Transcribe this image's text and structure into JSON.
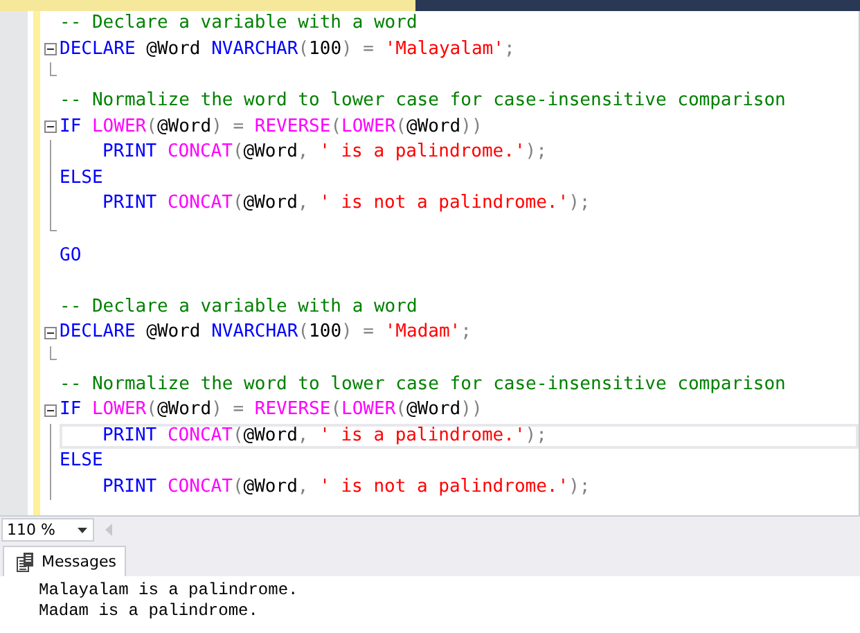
{
  "editor": {
    "lines": [
      {
        "kind": "plain",
        "tokens": [
          {
            "kind": "comment",
            "text": "-- Declare a variable with a word"
          }
        ]
      },
      {
        "kind": "fold-start",
        "tokens": [
          {
            "kind": "keyword",
            "text": "DECLARE"
          },
          {
            "kind": "plain",
            "text": " @Word "
          },
          {
            "kind": "keyword",
            "text": "NVARCHAR"
          },
          {
            "kind": "operator",
            "text": "("
          },
          {
            "kind": "plain",
            "text": "100"
          },
          {
            "kind": "operator",
            "text": ") = "
          },
          {
            "kind": "string",
            "text": "'Malayalam'"
          },
          {
            "kind": "operator",
            "text": ";"
          }
        ]
      },
      {
        "kind": "fold-end"
      },
      {
        "kind": "plain",
        "tokens": [
          {
            "kind": "comment",
            "text": "-- Normalize the word to lower case for case-insensitive comparison"
          }
        ]
      },
      {
        "kind": "fold-start",
        "tokens": [
          {
            "kind": "keyword",
            "text": "IF "
          },
          {
            "kind": "function",
            "text": "LOWER"
          },
          {
            "kind": "operator",
            "text": "("
          },
          {
            "kind": "plain",
            "text": "@Word"
          },
          {
            "kind": "operator",
            "text": ") = "
          },
          {
            "kind": "function",
            "text": "REVERSE"
          },
          {
            "kind": "operator",
            "text": "("
          },
          {
            "kind": "function",
            "text": "LOWER"
          },
          {
            "kind": "operator",
            "text": "("
          },
          {
            "kind": "plain",
            "text": "@Word"
          },
          {
            "kind": "operator",
            "text": "))"
          }
        ]
      },
      {
        "kind": "fold-body",
        "indented": true,
        "tokens": [
          {
            "kind": "keyword",
            "text": "PRINT "
          },
          {
            "kind": "function",
            "text": "CONCAT"
          },
          {
            "kind": "operator",
            "text": "("
          },
          {
            "kind": "plain",
            "text": "@Word"
          },
          {
            "kind": "operator",
            "text": ", "
          },
          {
            "kind": "string",
            "text": "' is a palindrome.'"
          },
          {
            "kind": "operator",
            "text": ");"
          }
        ]
      },
      {
        "kind": "fold-body",
        "tokens": [
          {
            "kind": "keyword",
            "text": "ELSE"
          }
        ]
      },
      {
        "kind": "fold-body",
        "indented": true,
        "tokens": [
          {
            "kind": "keyword",
            "text": "PRINT "
          },
          {
            "kind": "function",
            "text": "CONCAT"
          },
          {
            "kind": "operator",
            "text": "("
          },
          {
            "kind": "plain",
            "text": "@Word"
          },
          {
            "kind": "operator",
            "text": ", "
          },
          {
            "kind": "string",
            "text": "' is not a palindrome.'"
          },
          {
            "kind": "operator",
            "text": ");"
          }
        ]
      },
      {
        "kind": "fold-end"
      },
      {
        "kind": "plain",
        "tokens": [
          {
            "kind": "keyword",
            "text": "GO"
          }
        ]
      },
      {
        "kind": "plain"
      },
      {
        "kind": "plain",
        "tokens": [
          {
            "kind": "comment",
            "text": "-- Declare a variable with a word"
          }
        ]
      },
      {
        "kind": "fold-start",
        "tokens": [
          {
            "kind": "keyword",
            "text": "DECLARE"
          },
          {
            "kind": "plain",
            "text": " @Word "
          },
          {
            "kind": "keyword",
            "text": "NVARCHAR"
          },
          {
            "kind": "operator",
            "text": "("
          },
          {
            "kind": "plain",
            "text": "100"
          },
          {
            "kind": "operator",
            "text": ") = "
          },
          {
            "kind": "string",
            "text": "'Madam'"
          },
          {
            "kind": "operator",
            "text": ";"
          }
        ]
      },
      {
        "kind": "fold-end"
      },
      {
        "kind": "plain",
        "tokens": [
          {
            "kind": "comment",
            "text": "-- Normalize the word to lower case for case-insensitive comparison"
          }
        ]
      },
      {
        "kind": "fold-start",
        "tokens": [
          {
            "kind": "keyword",
            "text": "IF "
          },
          {
            "kind": "function",
            "text": "LOWER"
          },
          {
            "kind": "operator",
            "text": "("
          },
          {
            "kind": "plain",
            "text": "@Word"
          },
          {
            "kind": "operator",
            "text": ") = "
          },
          {
            "kind": "function",
            "text": "REVERSE"
          },
          {
            "kind": "operator",
            "text": "("
          },
          {
            "kind": "function",
            "text": "LOWER"
          },
          {
            "kind": "operator",
            "text": "("
          },
          {
            "kind": "plain",
            "text": "@Word"
          },
          {
            "kind": "operator",
            "text": "))"
          }
        ]
      },
      {
        "kind": "fold-body",
        "indented": true,
        "current": true,
        "tokens": [
          {
            "kind": "keyword",
            "text": "PRINT "
          },
          {
            "kind": "function",
            "text": "CONCAT"
          },
          {
            "kind": "operator",
            "text": "("
          },
          {
            "kind": "plain",
            "text": "@Word"
          },
          {
            "kind": "operator",
            "text": ", "
          },
          {
            "kind": "string",
            "text": "' is a palindrome.'"
          },
          {
            "kind": "operator",
            "text": ");"
          }
        ]
      },
      {
        "kind": "fold-body",
        "tokens": [
          {
            "kind": "keyword",
            "text": "ELSE"
          }
        ]
      },
      {
        "kind": "fold-body",
        "indented": true,
        "tokens": [
          {
            "kind": "keyword",
            "text": "PRINT "
          },
          {
            "kind": "function",
            "text": "CONCAT"
          },
          {
            "kind": "operator",
            "text": "("
          },
          {
            "kind": "plain",
            "text": "@Word"
          },
          {
            "kind": "operator",
            "text": ", "
          },
          {
            "kind": "string",
            "text": "' is not a palindrome.'"
          },
          {
            "kind": "operator",
            "text": ");"
          }
        ]
      }
    ]
  },
  "zoom": {
    "value": "110 %"
  },
  "results": {
    "tabs": [
      {
        "label": "Messages",
        "selected": true
      }
    ],
    "messages": [
      "Malayalam is a palindrome.",
      "Madam is a palindrome."
    ]
  }
}
